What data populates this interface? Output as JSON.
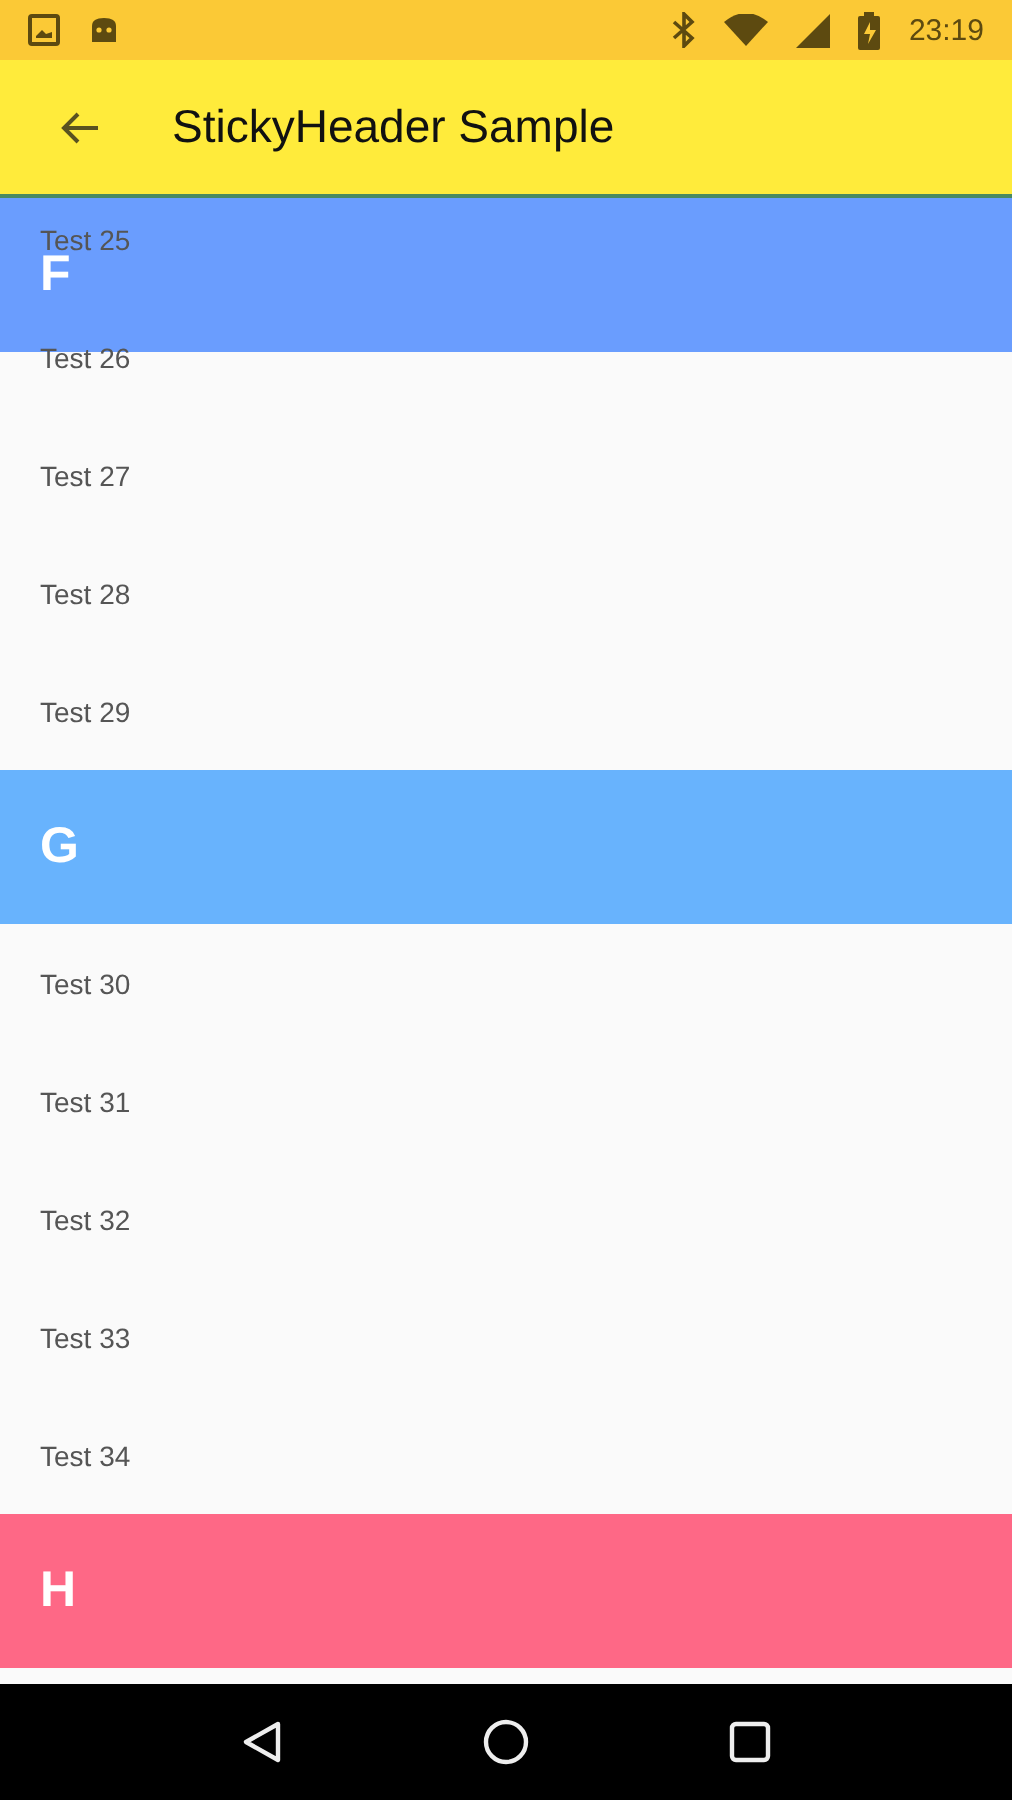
{
  "status_bar": {
    "time": "23:19"
  },
  "app_bar": {
    "title": "StickyHeader Sample"
  },
  "sticky_header": {
    "label": "F",
    "color": "#6a9dfe"
  },
  "items": [
    {
      "kind": "row",
      "label": "Test 25"
    },
    {
      "kind": "row",
      "label": "Test 26"
    },
    {
      "kind": "row",
      "label": "Test 27"
    },
    {
      "kind": "row",
      "label": "Test 28"
    },
    {
      "kind": "row",
      "label": "Test 29"
    },
    {
      "kind": "header",
      "label": "G",
      "color": "#68b3fd"
    },
    {
      "kind": "row",
      "label": "Test 30"
    },
    {
      "kind": "row",
      "label": "Test 31"
    },
    {
      "kind": "row",
      "label": "Test 32"
    },
    {
      "kind": "row",
      "label": "Test 33"
    },
    {
      "kind": "row",
      "label": "Test 34"
    },
    {
      "kind": "header",
      "label": "H",
      "color": "#fe6886"
    }
  ]
}
